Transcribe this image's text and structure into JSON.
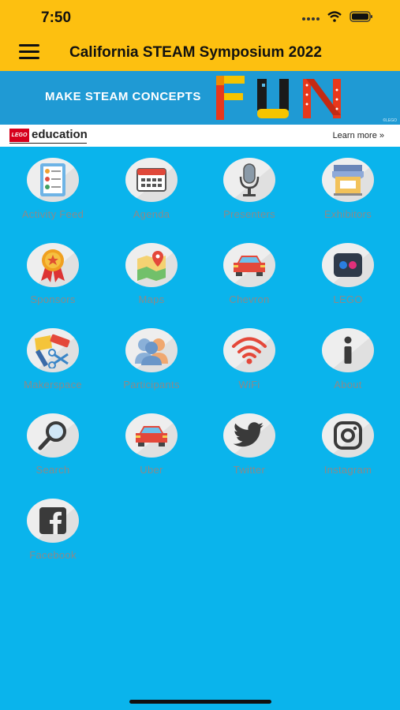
{
  "status_bar": {
    "time": "7:50"
  },
  "nav": {
    "title": "California STEAM Symposium 2022",
    "menu_icon": "hamburger-icon"
  },
  "banner": {
    "text": "MAKE STEAM CONCEPTS",
    "art_word": "FUN",
    "small_print": "©LEGO"
  },
  "ad": {
    "brand_mark": "LEGO",
    "brand": "education",
    "link": "Learn more »"
  },
  "tiles": [
    {
      "label": "Activity Feed",
      "icon": "activity-feed-icon"
    },
    {
      "label": "Agenda",
      "icon": "calendar-icon"
    },
    {
      "label": "Presenters",
      "icon": "microphone-icon"
    },
    {
      "label": "Exhibitors",
      "icon": "storefront-icon"
    },
    {
      "label": "Sponsors",
      "icon": "ribbon-icon"
    },
    {
      "label": "Maps",
      "icon": "map-icon"
    },
    {
      "label": "Chevron",
      "icon": "car-icon"
    },
    {
      "label": "LEGO",
      "icon": "flickr-icon"
    },
    {
      "label": "Makerspace",
      "icon": "tools-icon"
    },
    {
      "label": "Participants",
      "icon": "people-icon"
    },
    {
      "label": "WiFi",
      "icon": "wifi-icon"
    },
    {
      "label": "About",
      "icon": "info-icon"
    },
    {
      "label": "Search",
      "icon": "search-icon"
    },
    {
      "label": "Uber",
      "icon": "car-icon"
    },
    {
      "label": "Twitter",
      "icon": "twitter-icon"
    },
    {
      "label": "Instagram",
      "icon": "instagram-icon"
    },
    {
      "label": "Facebook",
      "icon": "facebook-icon"
    }
  ],
  "colors": {
    "header": "#fdc010",
    "background": "#0ab4ec",
    "banner": "#1f9ad4",
    "label": "#8a8a8a"
  }
}
